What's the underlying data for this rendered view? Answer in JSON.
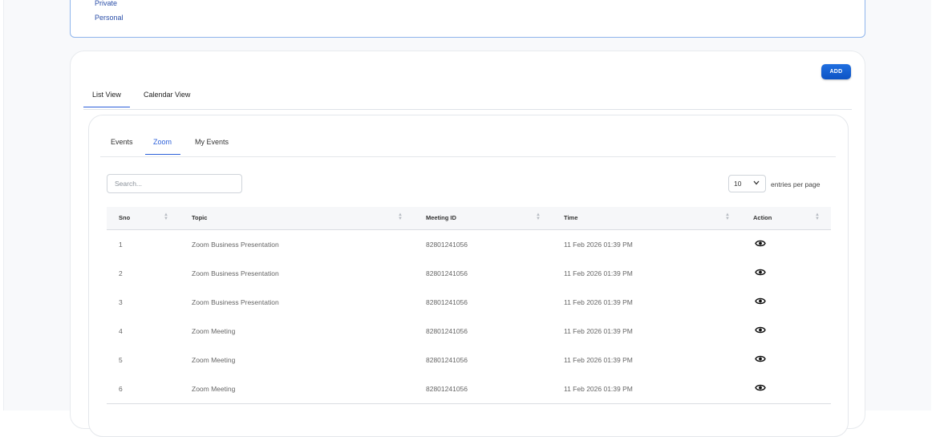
{
  "filters": [
    "Private",
    "Personal"
  ],
  "add_label": "ADD",
  "view_tabs": [
    "List View",
    "Calendar View"
  ],
  "sub_tabs": [
    "Events",
    "Zoom",
    "My Events"
  ],
  "search_placeholder": "Search...",
  "per_page": {
    "value": "10",
    "label": "entries per page"
  },
  "columns": [
    "Sno",
    "Topic",
    "Meeting ID",
    "Time",
    "Action"
  ],
  "rows": [
    {
      "sno": "1",
      "topic": "Zoom Business Presentation",
      "meeting_id": "82801241056",
      "time": "11 Feb 2026 01:39 PM"
    },
    {
      "sno": "2",
      "topic": "Zoom Business Presentation",
      "meeting_id": "82801241056",
      "time": "11 Feb 2026 01:39 PM"
    },
    {
      "sno": "3",
      "topic": "Zoom Business Presentation",
      "meeting_id": "82801241056",
      "time": "11 Feb 2026 01:39 PM"
    },
    {
      "sno": "4",
      "topic": "Zoom Meeting",
      "meeting_id": "82801241056",
      "time": "11 Feb 2026 01:39 PM"
    },
    {
      "sno": "5",
      "topic": "Zoom Meeting",
      "meeting_id": "82801241056",
      "time": "11 Feb 2026 01:39 PM"
    },
    {
      "sno": "6",
      "topic": "Zoom Meeting",
      "meeting_id": "82801241056",
      "time": "11 Feb 2026 01:39 PM"
    }
  ],
  "action_icon": "eye-icon",
  "colors": {
    "accent": "#2b5fd9",
    "button": "#1663d6",
    "link": "#2b4fa8"
  }
}
